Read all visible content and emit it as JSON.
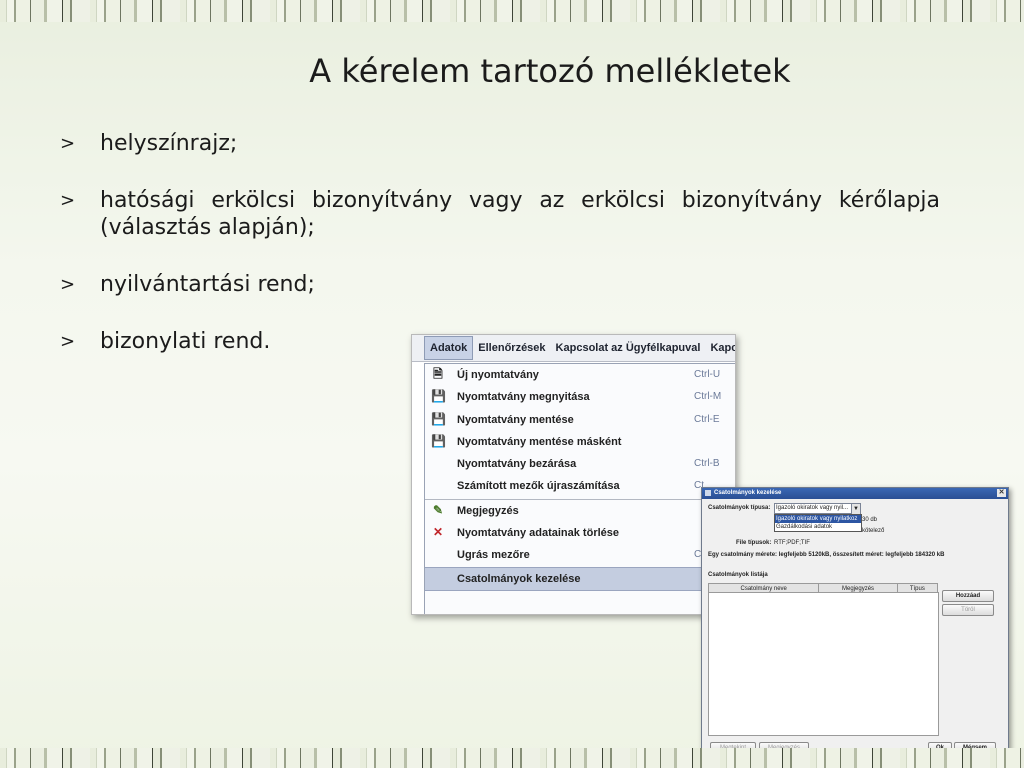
{
  "slide": {
    "title": "A kérelem tartozó mellékletek",
    "bullet_marker": ">",
    "bullets": [
      "helyszínrajz;",
      "hatósági erkölcsi bizonyítvány vagy az erkölcsi bizonyítvány kérőlapja (választás alapján);",
      "nyilvántartási rend;",
      "bizonylati rend."
    ]
  },
  "menu_screenshot": {
    "menubar": [
      "Adatok",
      "Ellenőrzések",
      "Kapcsolat az Ügyfélkapuval",
      "Kapcsolat a Hivatali K"
    ],
    "items": [
      {
        "label": "Új nyomtatvány",
        "shortcut": "Ctrl-U",
        "icon": "new-form-icon"
      },
      {
        "label": "Nyomtatvány megnyitása",
        "shortcut": "Ctrl-M",
        "icon": "open-form-icon"
      },
      {
        "label": "Nyomtatvány mentése",
        "shortcut": "Ctrl-E",
        "icon": "save-form-icon"
      },
      {
        "label": "Nyomtatvány mentése másként",
        "shortcut": "",
        "icon": "save-as-icon"
      },
      {
        "label": "Nyomtatvány bezárása",
        "shortcut": "Ctrl-B",
        "icon": ""
      },
      {
        "label": "Számított mezők újraszámítása",
        "shortcut": "Ct",
        "icon": ""
      },
      {
        "label": "Megjegyzés",
        "shortcut": "",
        "icon": "note-icon"
      },
      {
        "label": "Nyomtatvány adatainak törlése",
        "shortcut": "",
        "icon": "delete-icon"
      },
      {
        "label": "Ugrás mezőre",
        "shortcut": "Ct",
        "icon": ""
      },
      {
        "label": "Csatolmányok kezelése",
        "shortcut": "",
        "icon": ""
      }
    ]
  },
  "dialog": {
    "title": "Csatolmányok kezelése",
    "type_label": "Csatolmányok típusa:",
    "type_value": "Igazoló okiratok vagy nyil...",
    "dropdown_options": [
      "Igazoló okiratok vagy nyilatkoz",
      "Gazdálkodási adatok"
    ],
    "count_fragment": "30 db",
    "hidden_fragment": "kötelező",
    "file_types_label": "File típusok:",
    "file_types_value": "RTF;PDF;TIF",
    "size_info": "Egy csatolmány mérete: legfeljebb 5120kB, összesített méret: legfeljebb 184320 kB",
    "list_label": "Csatolmányok listája",
    "columns": [
      "Csatolmány neve",
      "Megjegyzés",
      "Típus"
    ],
    "buttons": {
      "add": "Hozzáad",
      "delete": "Töröl",
      "view": "Megtekint",
      "note": "Megjegyzés",
      "ok": "Ok",
      "cancel": "Mégsem"
    }
  }
}
